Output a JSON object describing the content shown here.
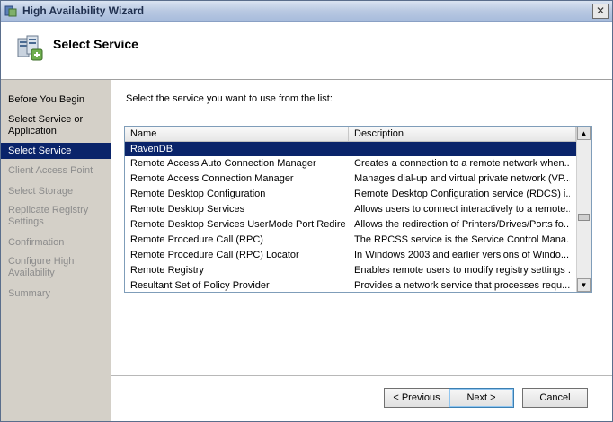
{
  "window": {
    "title": "High Availability Wizard",
    "close_symbol": "✕"
  },
  "header": {
    "title": "Select Service"
  },
  "nav": {
    "items": [
      {
        "label": "Before You Begin",
        "state": "normal"
      },
      {
        "label": "Select Service or Application",
        "state": "normal"
      },
      {
        "label": "Select Service",
        "state": "active"
      },
      {
        "label": "Client Access Point",
        "state": "disabled"
      },
      {
        "label": "Select Storage",
        "state": "disabled"
      },
      {
        "label": "Replicate Registry Settings",
        "state": "disabled"
      },
      {
        "label": "Confirmation",
        "state": "disabled"
      },
      {
        "label": "Configure High Availability",
        "state": "disabled"
      },
      {
        "label": "Summary",
        "state": "disabled"
      }
    ]
  },
  "main": {
    "prompt": "Select the service you want to use from the list:",
    "columns": {
      "name": "Name",
      "description": "Description"
    },
    "rows": [
      {
        "name": "RavenDB",
        "description": "",
        "selected": true
      },
      {
        "name": "Remote Access Auto Connection Manager",
        "description": "Creates a connection to a remote network when..."
      },
      {
        "name": "Remote Access Connection Manager",
        "description": "Manages dial-up and virtual private network (VP..."
      },
      {
        "name": "Remote Desktop Configuration",
        "description": "Remote Desktop Configuration service (RDCS) i..."
      },
      {
        "name": "Remote Desktop Services",
        "description": "Allows users to connect interactively to a remote..."
      },
      {
        "name": "Remote Desktop Services UserMode Port Redire...",
        "description": "Allows the redirection of Printers/Drives/Ports fo..."
      },
      {
        "name": "Remote Procedure Call (RPC)",
        "description": "The RPCSS service is the Service Control Mana..."
      },
      {
        "name": "Remote Procedure Call (RPC) Locator",
        "description": "In Windows 2003 and earlier versions of Windo..."
      },
      {
        "name": "Remote Registry",
        "description": "Enables remote users to modify registry settings ..."
      },
      {
        "name": "Resultant Set of Policy Provider",
        "description": "Provides a network service that processes requ..."
      }
    ]
  },
  "buttons": {
    "previous": "< Previous",
    "next": "Next >",
    "cancel": "Cancel"
  },
  "colors": {
    "selection": "#0a246a",
    "disabled_text": "#8c8c8c"
  }
}
